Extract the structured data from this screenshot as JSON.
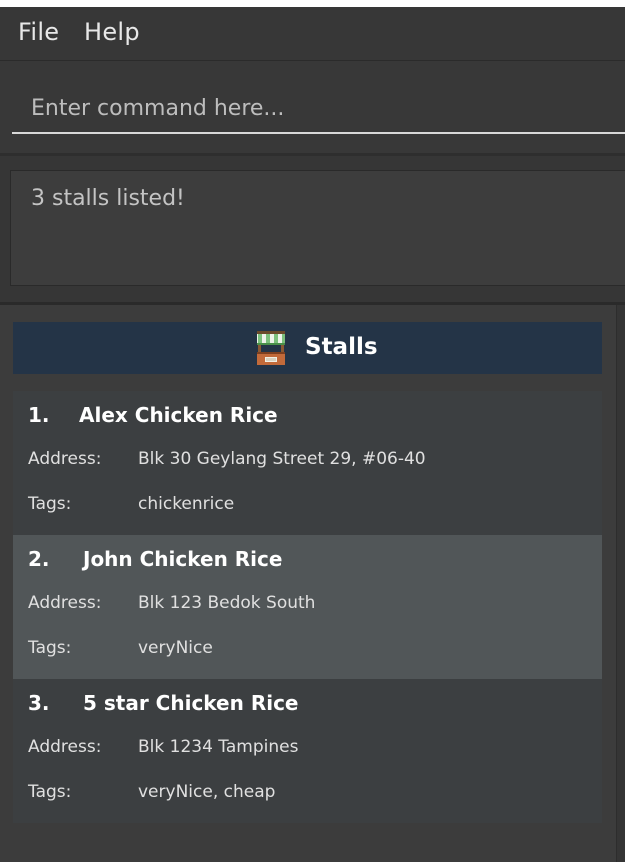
{
  "menu": {
    "file_label": "File",
    "help_label": "Help"
  },
  "command": {
    "placeholder": "Enter command here...",
    "value": ""
  },
  "result": {
    "message": "3 stalls listed!"
  },
  "list": {
    "header_title": "Stalls",
    "header_icon": "stall-icon",
    "address_label": "Address:",
    "tags_label": "Tags:",
    "selected_index": 1,
    "stalls": [
      {
        "index": "1.",
        "name": "Alex Chicken Rice",
        "address": "Blk 30 Geylang Street 29, #06-40",
        "tags": "chickenrice"
      },
      {
        "index": "2.",
        "name": "John Chicken Rice",
        "address": "Blk 123 Bedok South",
        "tags": "veryNice"
      },
      {
        "index": "3.",
        "name": "5 star Chicken Rice",
        "address": "Blk 1234 Tampines",
        "tags": "veryNice, cheap"
      }
    ]
  },
  "colors": {
    "header_bg": "#243447",
    "selected_card_bg": "#515658",
    "card_bg": "#3c3f41",
    "window_bg": "#3c3c3c"
  }
}
